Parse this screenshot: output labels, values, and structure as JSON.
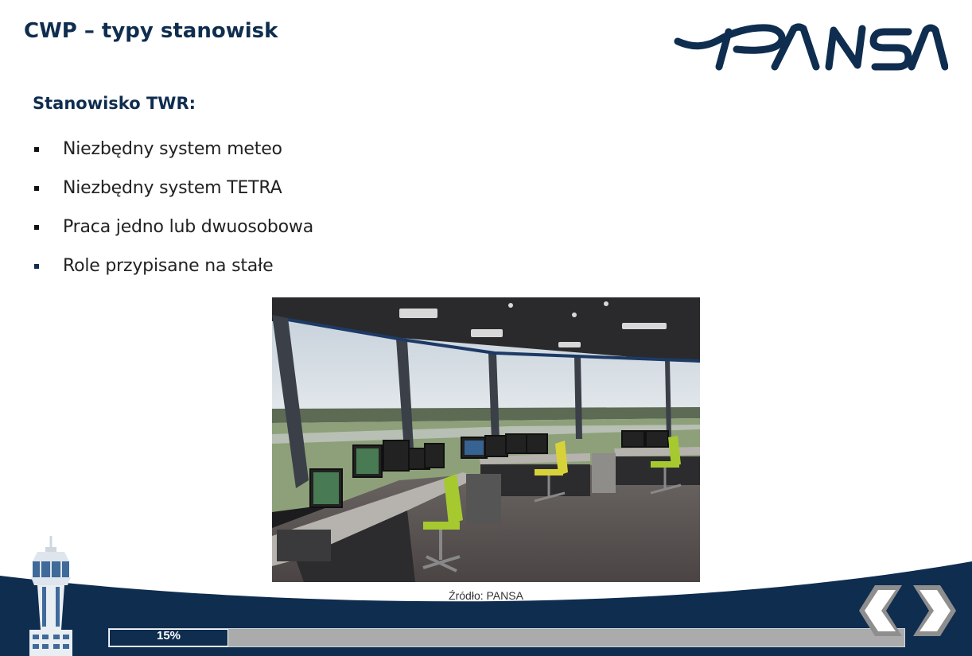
{
  "slide": {
    "title": "CWP – typy stanowisk",
    "logo_text": "PANSA",
    "heading": "Stanowisko TWR:",
    "bullets": [
      "Niezbędny system meteo",
      "Niezbędny system TETRA",
      "Praca jedno lub dwuosobowa",
      "Role przypisane na stałe"
    ],
    "image_caption": "Źródło: PANSA"
  },
  "footer": {
    "progress_label": "15%",
    "progress_value": 0.15,
    "prev_icon": "chevron-left-icon",
    "next_icon": "chevron-right-icon",
    "tower_icon": "control-tower-icon"
  },
  "colors": {
    "navy": "#0f2d4f",
    "grey": "#ababab",
    "white": "#ffffff"
  }
}
